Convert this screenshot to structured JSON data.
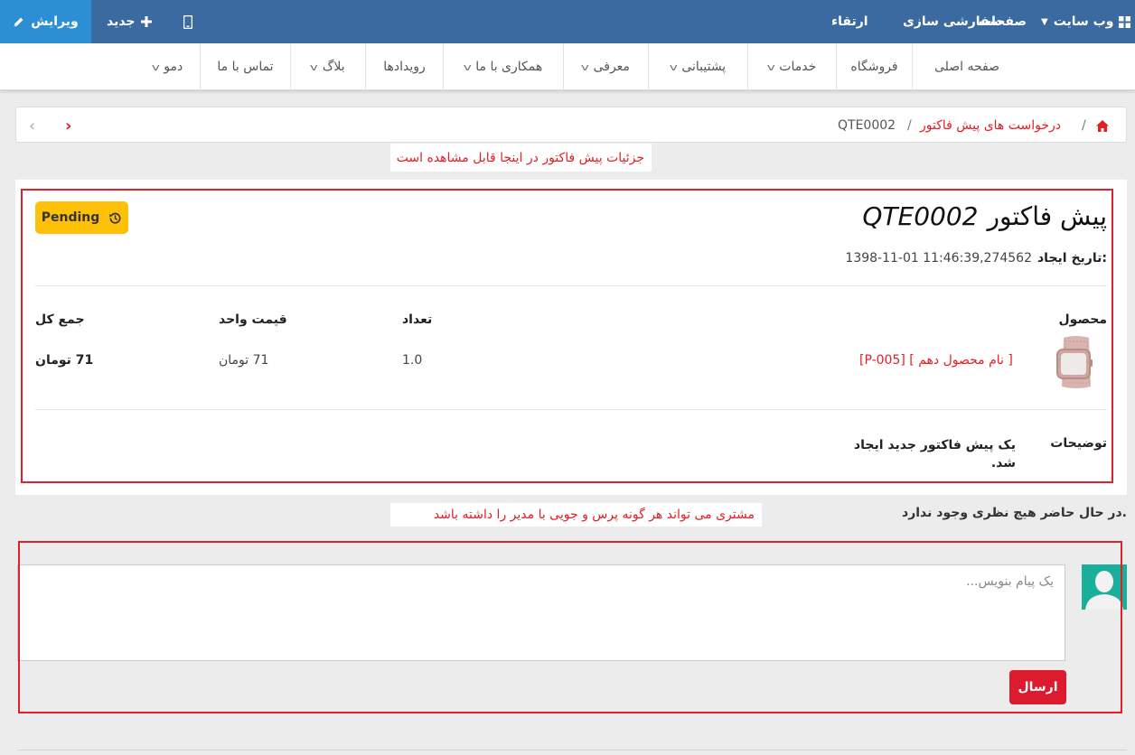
{
  "adminbar": {
    "edit_label": "ویرایش",
    "new_label": "جدید",
    "website_label": "وب سایت",
    "pages_label": "صفحات",
    "customize_label": "سفارشی سازی",
    "upgrade_label": "ارتقاء"
  },
  "menu": {
    "items": [
      {
        "label": "صفحه اصلی",
        "has_dropdown": false
      },
      {
        "label": "فروشگاه",
        "has_dropdown": false
      },
      {
        "label": "خدمات",
        "has_dropdown": true
      },
      {
        "label": "پشتیبانی",
        "has_dropdown": true
      },
      {
        "label": "معرفی",
        "has_dropdown": true
      },
      {
        "label": "همکاری با ما",
        "has_dropdown": true
      },
      {
        "label": "رویدادها",
        "has_dropdown": false
      },
      {
        "label": "بلاگ",
        "has_dropdown": true
      },
      {
        "label": "تماس با ما",
        "has_dropdown": false
      },
      {
        "label": "دمو",
        "has_dropdown": true
      }
    ]
  },
  "breadcrumb": {
    "parent_label": "درخواست های پیش فاکتور",
    "separator": "/",
    "current_label": "QTE0002"
  },
  "annotations": {
    "top_note": "جزئیات پیش فاکتور در اینجا قابل مشاهده است",
    "comment_note": "مشتری می تواند هر گونه پرس و جویی با مدیر را داشته باشد"
  },
  "quote": {
    "title_prefix": "پیش فاکتور",
    "number": "QTE0002",
    "status_label": "Pending",
    "created_label": "تاریخ ایجاد:",
    "created_value": "1398-11-01 11:46:39,274562",
    "columns": {
      "product": "محصول",
      "quantity": "تعداد",
      "unit_price": "قیمت واحد",
      "total": "جمع کل"
    },
    "line": {
      "product_name": "[P-005] [ نام محصول دهم ]",
      "quantity": "1.0",
      "unit_price": "71 تومان",
      "total": "71 تومان"
    },
    "notes_label": "توضیحات",
    "notes_line1": "یک پیش فاکتور جدید ایجاد",
    "notes_line2": "شد."
  },
  "comments": {
    "empty_text": "در حال حاضر هیچ نظری وجود ندارد.",
    "placeholder": "یک پیام بنویس...",
    "send_label": "ارسال"
  },
  "colors": {
    "adminbar": "#3b6aa0",
    "edit_button": "#2d8fd3",
    "pending_badge": "#ffc107",
    "annotation_red": "#e31e24",
    "send_button": "#dc1c2e",
    "avatar_bg": "#1aaf9a"
  }
}
